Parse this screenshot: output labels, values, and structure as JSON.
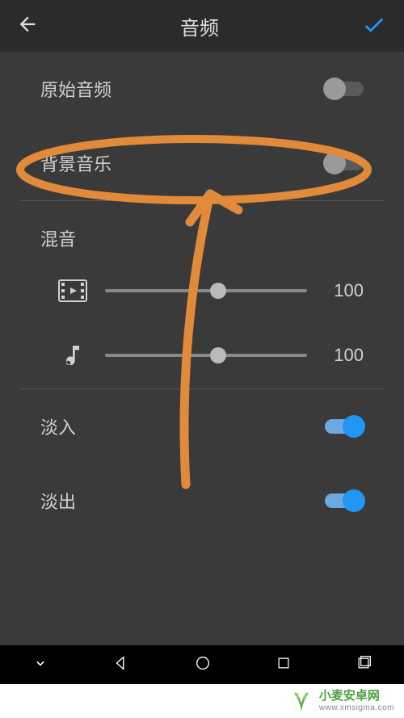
{
  "header": {
    "title": "音频"
  },
  "settings": {
    "original_audio": {
      "label": "原始音频",
      "value": false
    },
    "background_music": {
      "label": "背景音乐",
      "value": false
    },
    "fade_in": {
      "label": "淡入",
      "value": true
    },
    "fade_out": {
      "label": "淡出",
      "value": true
    }
  },
  "mixer": {
    "label": "混音",
    "video_volume": {
      "value": 100,
      "display": "100",
      "position": 56
    },
    "music_volume": {
      "value": 100,
      "display": "100",
      "position": 56
    }
  },
  "watermark": {
    "title": "小麦安卓网",
    "url": "www.xmsigma.com"
  },
  "colors": {
    "accent": "#2196f3",
    "annotation": "#e08a3a"
  }
}
